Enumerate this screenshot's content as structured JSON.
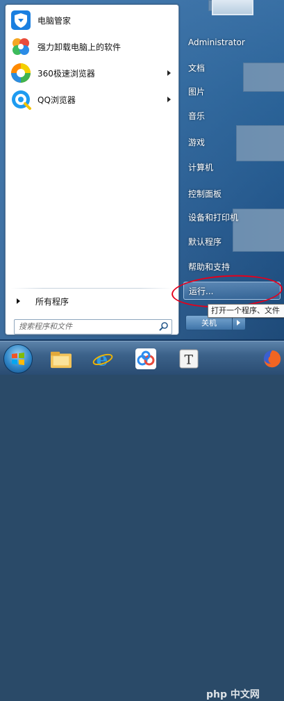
{
  "pinned_apps": [
    {
      "label": "电脑管家",
      "icon": "shield-icon"
    },
    {
      "label": "强力卸载电脑上的软件",
      "icon": "pinwheel-icon"
    },
    {
      "label": "360极速浏览器",
      "icon": "360-browser-icon"
    },
    {
      "label": "QQ浏览器",
      "icon": "qq-browser-icon"
    }
  ],
  "all_programs": "所有程序",
  "search": {
    "placeholder": "搜索程序和文件"
  },
  "right_pane": {
    "user": "Administrator",
    "items": [
      "文档",
      "图片",
      "音乐",
      "游戏",
      "计算机",
      "控制面板",
      "设备和打印机",
      "默认程序",
      "帮助和支持",
      "运行..."
    ]
  },
  "shutdown": {
    "label": "关机"
  },
  "tooltip": "打开一个程序、文件",
  "watermark": "php 中文网",
  "colors": {
    "highlight_ring": "#e4001c",
    "accent": "#2f6fa8"
  }
}
